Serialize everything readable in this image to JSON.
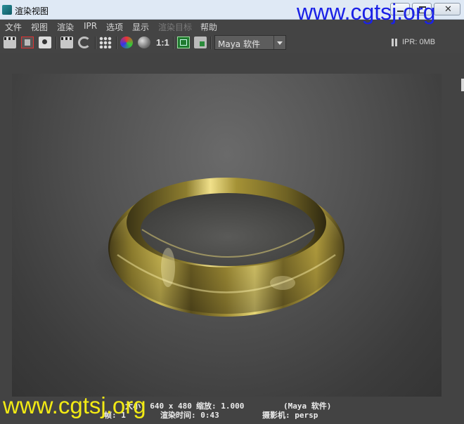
{
  "window": {
    "title": "渲染视图",
    "buttons": [
      "minimize",
      "maximize",
      "close"
    ],
    "close_glyph": "✕"
  },
  "menu": {
    "items": [
      {
        "label": "文件",
        "enabled": true
      },
      {
        "label": "视图",
        "enabled": true
      },
      {
        "label": "渲染",
        "enabled": true
      },
      {
        "label": "IPR",
        "enabled": true
      },
      {
        "label": "选项",
        "enabled": true
      },
      {
        "label": "显示",
        "enabled": true
      },
      {
        "label": "渲染目标",
        "enabled": false
      },
      {
        "label": "帮助",
        "enabled": true
      }
    ]
  },
  "toolbar": {
    "icons": [
      "redo-render-icon",
      "render-region-icon",
      "snapshot-icon",
      "ipr-render-icon",
      "refresh-ipr-icon",
      "render-sequence-icon",
      "rgb-channels-icon",
      "alpha-channel-icon",
      "real-size-icon",
      "keep-image-icon",
      "remove-image-icon"
    ],
    "one_to_one": "1:1",
    "renderer": "Maya 软件",
    "ipr_memory": "IPR: 0MB"
  },
  "status": {
    "line1_left": "大小: 640 x 480",
    "line1_zoom": "缩放: 1.000",
    "line1_renderer": "(Maya 软件)",
    "line2_frame": "帧: 1",
    "line2_time": "渲染时间: 0:43",
    "line2_camera": "摄影机: persp"
  },
  "watermarks": {
    "top": "www.cgtsj.org",
    "bottom": "www.cgtsj.org"
  },
  "colors": {
    "background": "#444444",
    "titlebar": "#dfe9f5",
    "watermark_top": "#1a21e6",
    "watermark_bottom": "#f2ea14",
    "ring_gold": "#a89232"
  }
}
